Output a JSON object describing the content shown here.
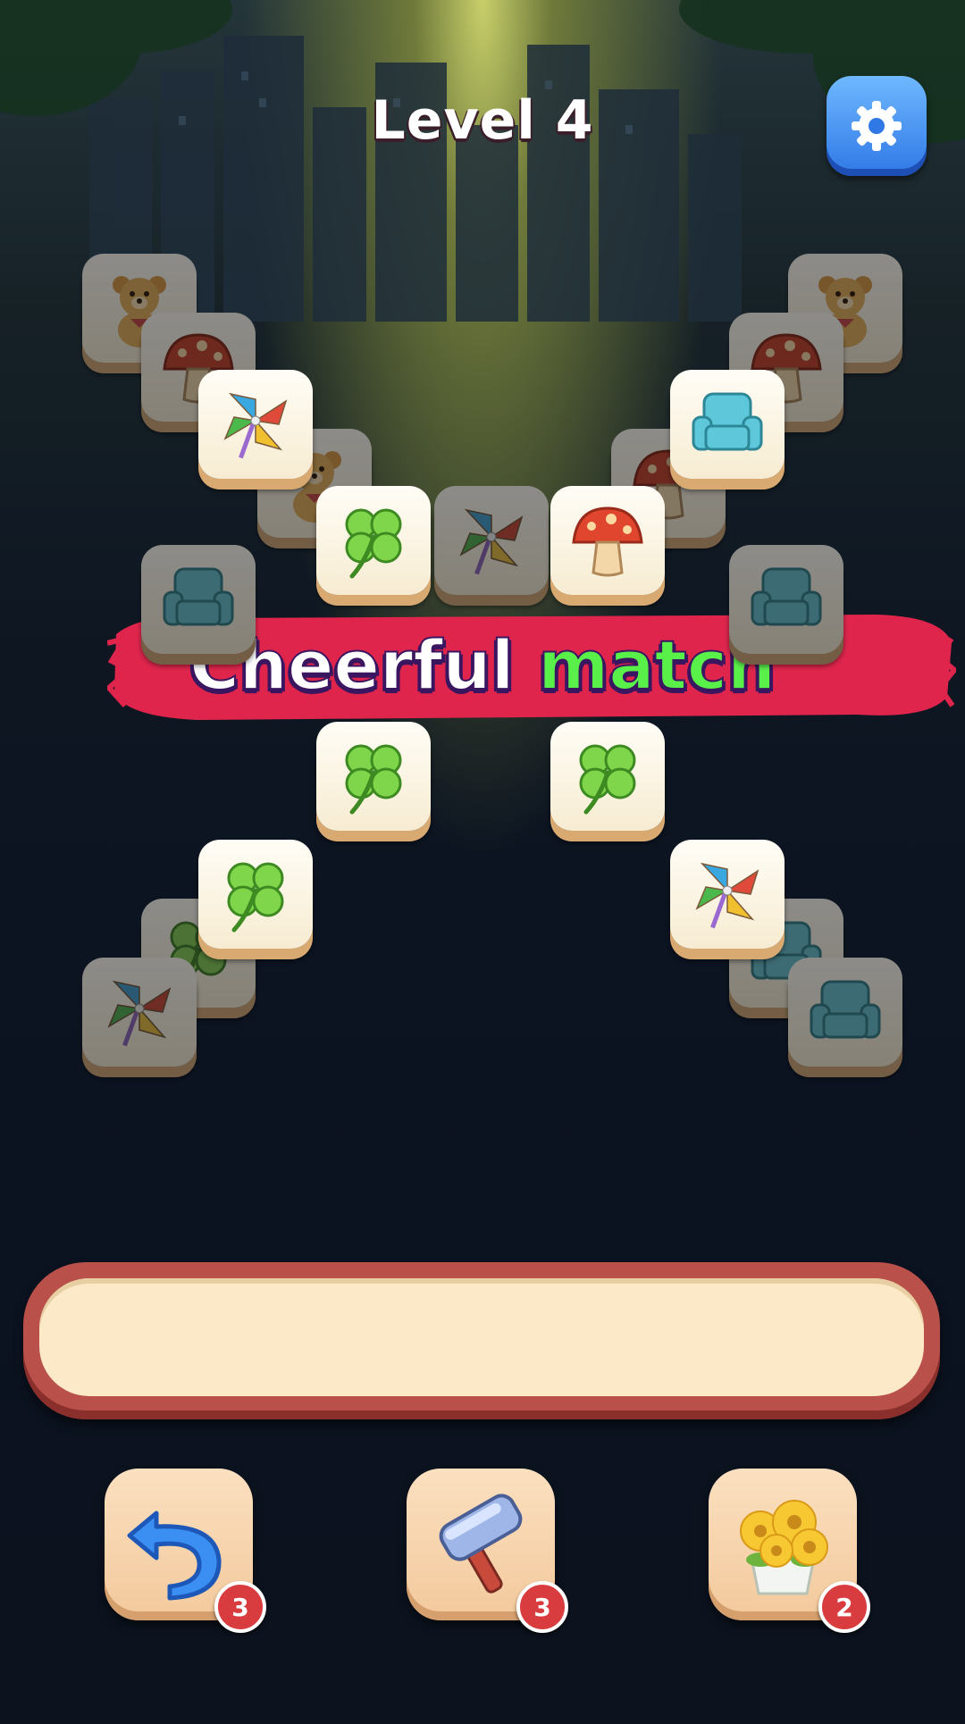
{
  "header": {
    "level_title": "Level 4",
    "settings_icon": "gear-icon"
  },
  "banner": {
    "text_part1": "Cheerful",
    "text_part2": "match",
    "accent_color": "#5af04a",
    "banner_color": "#e0254c"
  },
  "tray": {
    "slots_filled": 0
  },
  "powerups": [
    {
      "name": "undo",
      "icon": "undo-arrow-icon",
      "count": "3"
    },
    {
      "name": "hammer",
      "icon": "hammer-icon",
      "count": "3"
    },
    {
      "name": "flowers",
      "icon": "flower-pot-icon",
      "count": "2"
    }
  ],
  "tiles": [
    {
      "icon": "teddy-bear-icon"
    },
    {
      "icon": "mushroom-icon"
    },
    {
      "icon": "pinwheel-icon"
    },
    {
      "icon": "teddy-bear-icon"
    },
    {
      "icon": "clover-icon"
    },
    {
      "icon": "pinwheel-icon"
    },
    {
      "icon": "mushroom-icon"
    },
    {
      "icon": "teddy-bear-icon"
    },
    {
      "icon": "mushroom-icon"
    },
    {
      "icon": "armchair-icon"
    },
    {
      "icon": "mushroom-icon"
    },
    {
      "icon": "armchair-icon"
    },
    {
      "icon": "armchair-icon"
    },
    {
      "icon": "clover-icon"
    },
    {
      "icon": "clover-icon"
    },
    {
      "icon": "clover-icon"
    },
    {
      "icon": "clover-icon"
    },
    {
      "icon": "pinwheel-icon"
    },
    {
      "icon": "pinwheel-icon"
    },
    {
      "icon": "armchair-icon"
    },
    {
      "icon": "armchair-icon"
    }
  ]
}
